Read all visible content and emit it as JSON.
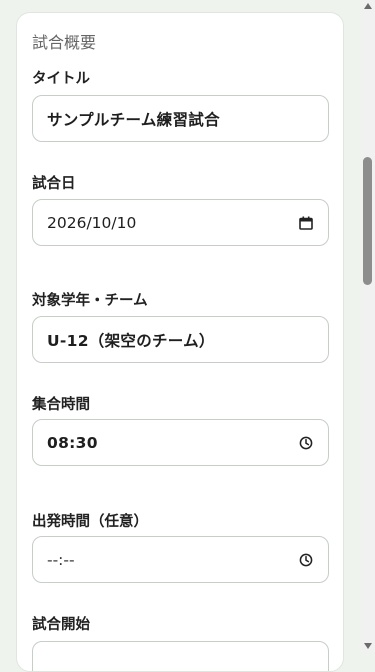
{
  "section": {
    "title": "試合概要"
  },
  "fields": {
    "title": {
      "label": "タイトル",
      "value": "サンプルチーム練習試合"
    },
    "date": {
      "label": "試合日",
      "value": "2026/10/10",
      "icon": "calendar-icon"
    },
    "target": {
      "label": "対象学年・チーム",
      "value": "U-12（架空のチーム）"
    },
    "gather": {
      "label": "集合時間",
      "value": "08:30",
      "icon": "clock-icon"
    },
    "depart": {
      "label": "出発時間（任意）",
      "value": "--:--",
      "icon": "clock-icon"
    },
    "start": {
      "label": "試合開始",
      "value": ""
    }
  }
}
